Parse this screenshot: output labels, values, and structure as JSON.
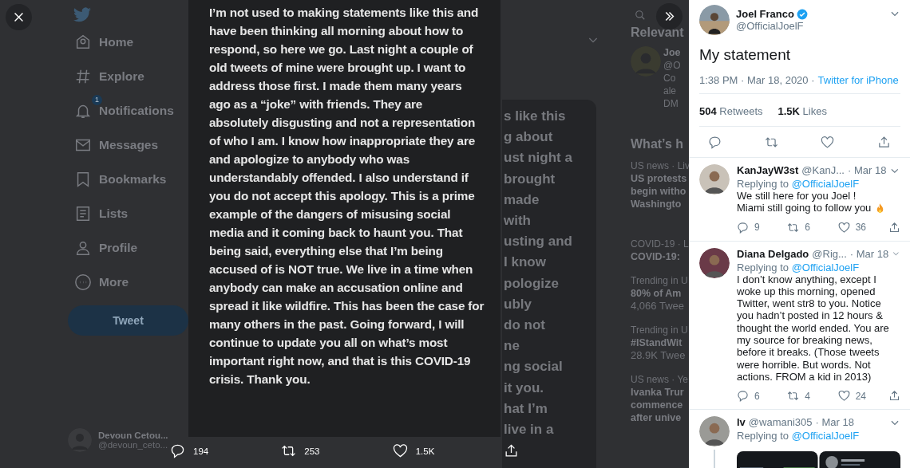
{
  "sidebar": {
    "items": [
      {
        "label": "Home",
        "kind": "home"
      },
      {
        "label": "Explore",
        "kind": "hash"
      },
      {
        "label": "Notifications",
        "kind": "bell",
        "badge": "1"
      },
      {
        "label": "Messages",
        "kind": "mail"
      },
      {
        "label": "Bookmarks",
        "kind": "bookmark"
      },
      {
        "label": "Lists",
        "kind": "list"
      },
      {
        "label": "Profile",
        "kind": "person"
      },
      {
        "label": "More",
        "kind": "more"
      }
    ],
    "tweet_button": "Tweet",
    "account": {
      "name": "Devoun Cetou...",
      "handle": "@devoun_ceto..."
    }
  },
  "backdrop": {
    "lines": [
      "s like this",
      "g about",
      "ust night a",
      "brought",
      "made",
      "with",
      "usting and",
      "I know",
      "pologize",
      "ubly",
      "do not",
      "ne",
      "ng social",
      "it you.",
      "hat I’m",
      "live in a"
    ]
  },
  "side_column": {
    "heading": "Relevant",
    "card": {
      "lines": [
        "Joe",
        "@O",
        "Co",
        "ale",
        "DM"
      ]
    },
    "trends_heading": "What’s h",
    "trends": [
      {
        "context": "US news · Liv",
        "lines": [
          "US protests",
          "begin witho",
          "Washingto"
        ]
      },
      {
        "context": "COVID-19 · L",
        "lines": [
          "COVID-19:"
        ]
      },
      {
        "context": "Trending in U",
        "lines": [
          "80% of Am"
        ],
        "count": "4,066 Twee"
      },
      {
        "context": "Trending in U",
        "lines": [
          "#IStandWit"
        ],
        "count": "28.9K Twee"
      },
      {
        "context": "US news · Ye",
        "lines": [
          "Ivanka Trur",
          "commence",
          "after unive"
        ]
      }
    ]
  },
  "statement": {
    "text": "I’m not used to making statements like this and have been thinking all morning about how to respond, so here we go. Last night a couple of old tweets of mine were brought up. I want to address those first. I made them many years ago as a “joke” with friends. They are absolutely disgusting and not a representation of who I am. I know how inappropriate they are and apologize to anybody who was understandably offended. I also understand if you do not accept this apology. This is a prime example of the dangers of misusing social media and it coming back to haunt you. That being said, everything else that I’m being accused of is NOT true. We live in a time when anybody can make an accusation online and spread it like wildfire. This has been the case for many others in the past. Going forward, I will continue to update you all on what’s most important right now, and that is this COVID-19 crisis. Thank you."
  },
  "media_actions": [
    {
      "kind": "reply",
      "count": "194"
    },
    {
      "kind": "retweet",
      "count": "253"
    },
    {
      "kind": "like",
      "count": "1.5K"
    },
    {
      "kind": "share"
    }
  ],
  "tweet": {
    "name": "Joel Franco",
    "verified": true,
    "handle": "@OfficialJoelF",
    "text": "My statement",
    "time": "1:38 PM · Mar 18, 2020 ·",
    "source": "Twitter for iPhone",
    "retweets": "504",
    "retweets_label": "Retweets",
    "likes": "1.5K",
    "likes_label": "Likes"
  },
  "replies": [
    {
      "name": "KanJayW3st",
      "handle": "@KanJ...",
      "date": "· Mar 18",
      "replying_label": "Replying to",
      "replying_to": "@OfficialJoelF",
      "text": "We still here for you Joel !\nMiami still going to follow you",
      "end_mark": {
        "kind": "flame"
      },
      "replies": "9",
      "retweets": "6",
      "likes": "36"
    },
    {
      "name": "Diana Delgado",
      "handle": "@Rig...",
      "date": "· Mar 18",
      "replying_label": "Replying to",
      "replying_to": "@OfficialJoelF",
      "text": "I don’t know anything, except I woke up this morning, opened Twitter, went str8 to you. Notice you hadn’t posted in 12 hours & thought the world ended. You are my source for breaking news, before it breaks. (Those tweets were horrible. But words. Not actions. FROM a kid in 2013)",
      "replies": "6",
      "retweets": "4",
      "likes": "24"
    },
    {
      "name": "lv",
      "handle": "@wamani305",
      "date": "· Mar 18",
      "replying_label": "Replying to",
      "replying_to": "@OfficialJoelF"
    }
  ]
}
